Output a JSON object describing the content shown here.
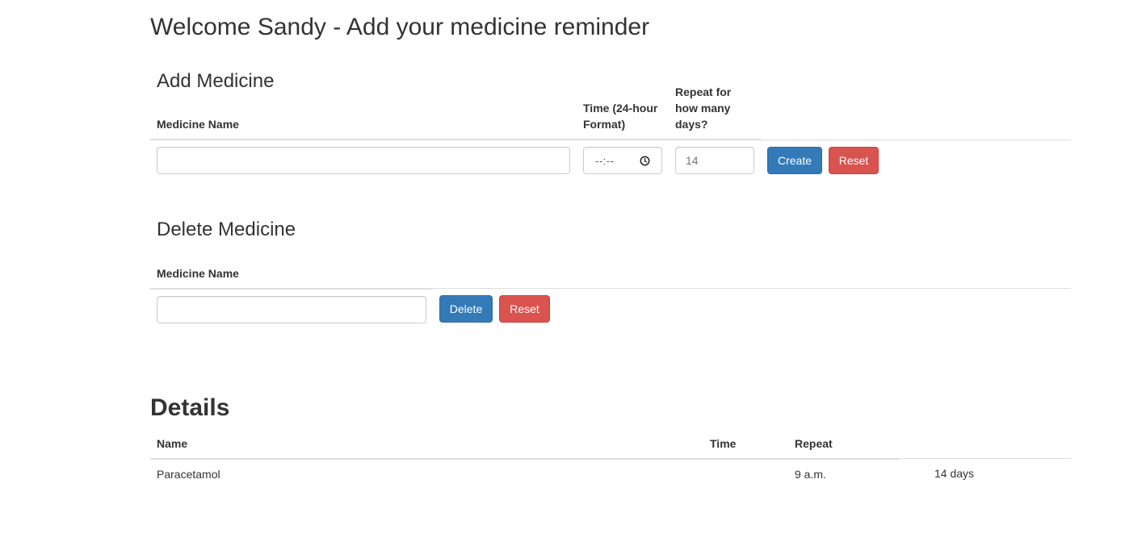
{
  "page": {
    "title": "Welcome Sandy - Add your medicine reminder"
  },
  "add_section": {
    "heading": "Add Medicine",
    "col_name": "Medicine Name",
    "col_time_line1": "Time (24-hour",
    "col_time_line2": "Format)",
    "col_repeat_line1": "Repeat for",
    "col_repeat_line2": "how many",
    "col_repeat_line3": "days?",
    "name_value": "",
    "time_placeholder": "--:--",
    "repeat_placeholder": "14",
    "create_label": "Create",
    "reset_label": "Reset"
  },
  "delete_section": {
    "heading": "Delete Medicine",
    "col_name": "Medicine Name",
    "name_value": "",
    "delete_label": "Delete",
    "reset_label": "Reset"
  },
  "details": {
    "heading": "Details",
    "columns": [
      "Name",
      "Time",
      "Repeat"
    ],
    "rows": [
      {
        "name": "Paracetamol",
        "time": "9 a.m.",
        "repeat": "14 days"
      }
    ]
  },
  "colors": {
    "primary": "#337ab7",
    "danger": "#d9534f",
    "text": "#333333",
    "border": "#dddddd"
  },
  "icons": {
    "time_input_icon": "clock-icon"
  }
}
